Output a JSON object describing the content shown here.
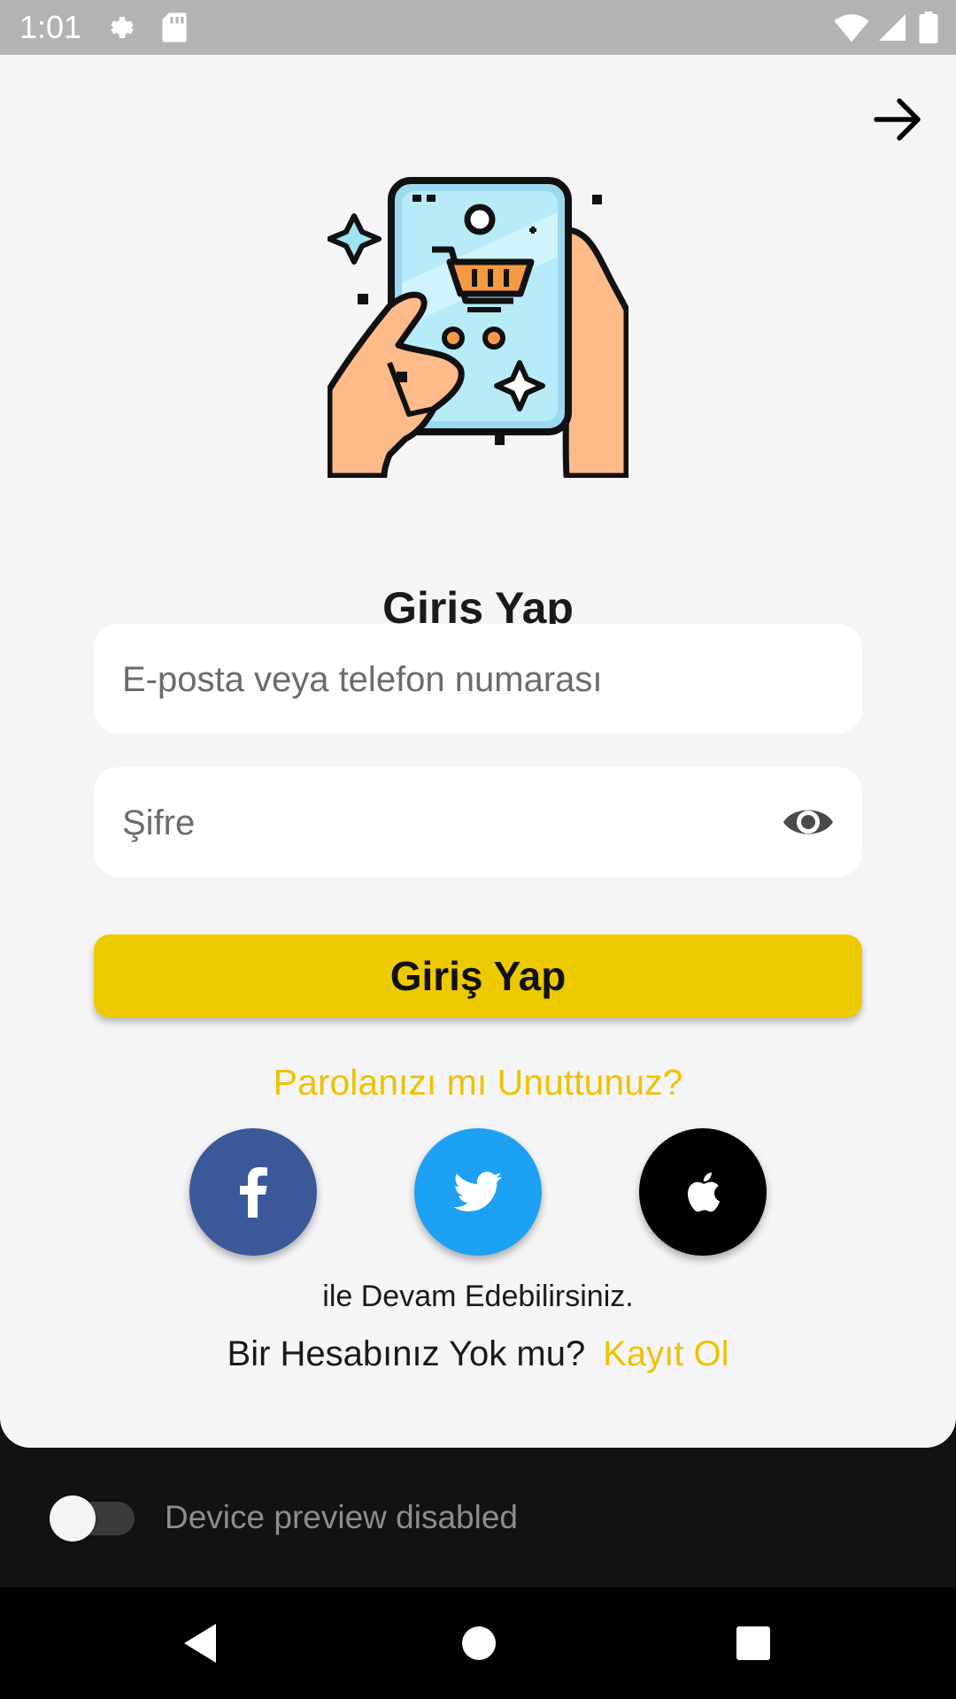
{
  "status_bar": {
    "time": "1:01",
    "icons": [
      "gear-icon",
      "sd-card-icon",
      "wifi-icon",
      "signal-icon",
      "battery-icon"
    ]
  },
  "header": {
    "next_icon": "arrow-right-icon"
  },
  "hero": {
    "image": "phone-shopping-cart-illustration"
  },
  "login": {
    "title": "Giriş Yap",
    "email_placeholder": "E-posta veya telefon numarası",
    "email_value": "",
    "password_placeholder": "Şifre",
    "password_value": "",
    "show_password_icon": "eye-icon",
    "submit_label": "Giriş Yap",
    "forgot_label": "Parolanızı mı Unuttunuz?"
  },
  "social": {
    "buttons": [
      {
        "name": "facebook",
        "icon": "facebook-icon",
        "color": "#3b5998"
      },
      {
        "name": "twitter",
        "icon": "twitter-icon",
        "color": "#1da1f2"
      },
      {
        "name": "apple",
        "icon": "apple-icon",
        "color": "#000000"
      }
    ],
    "continue_text": "ile Devam Edebilirsiniz."
  },
  "signup": {
    "prompt": "Bir Hesabınız Yok mu?",
    "link": "Kayıt Ol"
  },
  "device_preview": {
    "label": "Device preview disabled",
    "enabled": false
  },
  "nav": {
    "icons": [
      "back-icon",
      "home-icon",
      "recents-icon"
    ]
  },
  "colors": {
    "accent": "#edc900",
    "link": "#edc200",
    "background": "#f5f5f7"
  }
}
